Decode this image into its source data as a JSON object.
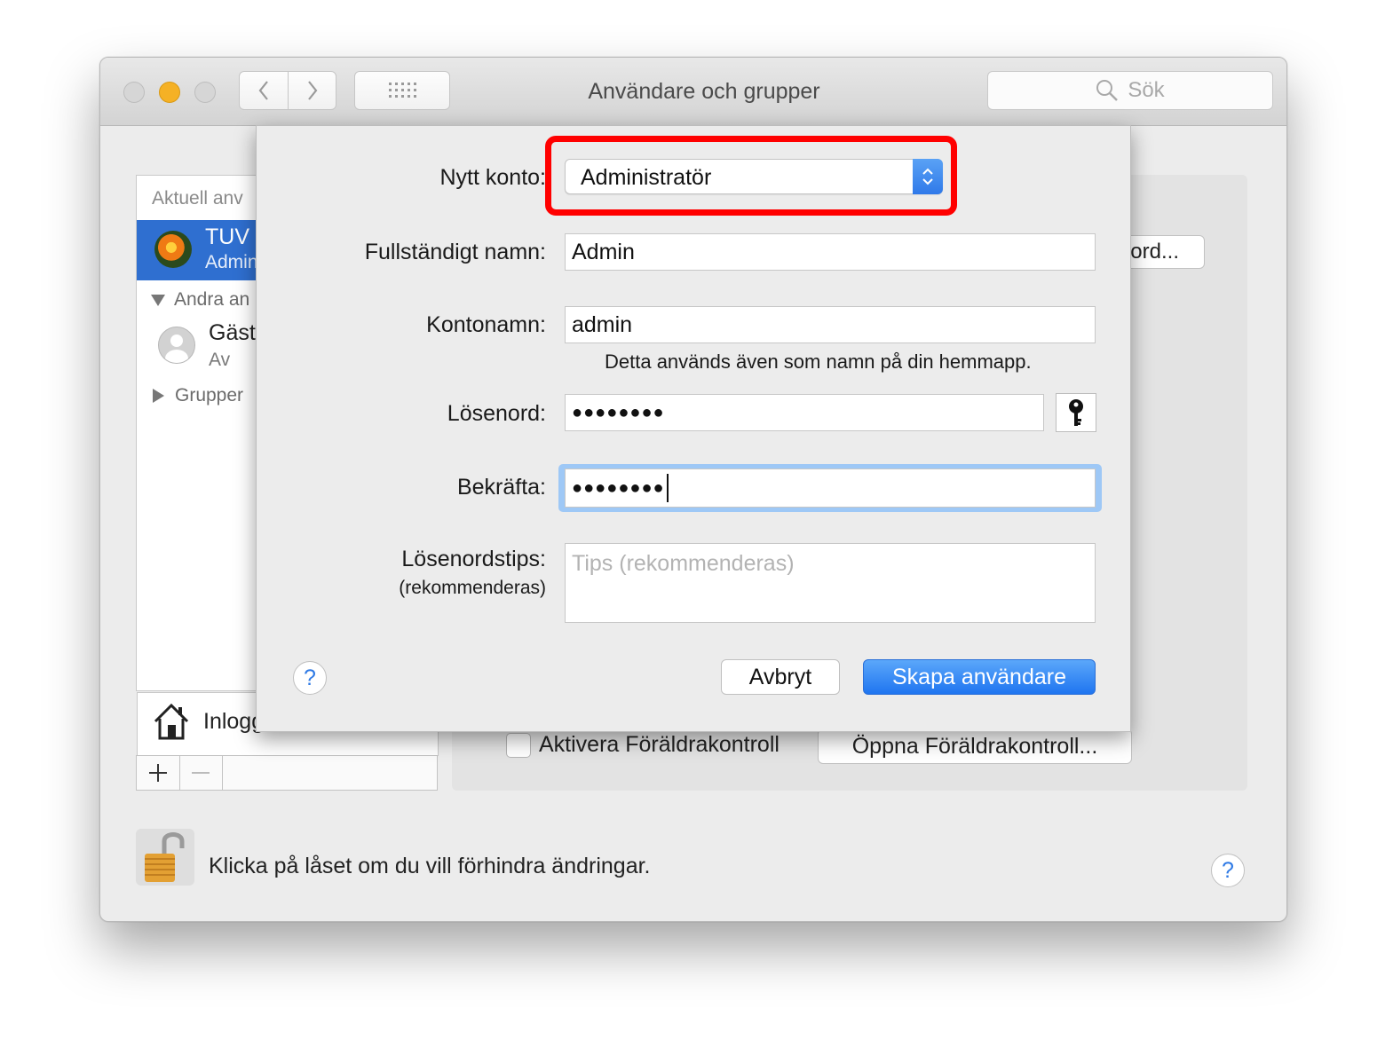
{
  "window": {
    "title": "Användare och grupper",
    "search_placeholder": "Sök"
  },
  "sidebar": {
    "header": "Aktuell anv",
    "current_user": {
      "name": "TUV",
      "role": "Admin"
    },
    "other_users_header": "Andra an",
    "guest": {
      "name": "Gäst",
      "status": "Av"
    },
    "groups_label": "Grupper",
    "login_options": "Inlogg"
  },
  "panel": {
    "password_button": "ord...",
    "parental_checkbox_label": "Aktivera Föräldrakontroll",
    "parental_open_button": "Öppna Föräldrakontroll..."
  },
  "lock": {
    "text": "Klicka på låset om du vill förhindra ändringar."
  },
  "sheet": {
    "new_account_label": "Nytt konto:",
    "account_type": "Administratör",
    "full_name_label": "Fullständigt namn:",
    "full_name_value": "Admin",
    "account_name_label": "Kontonamn:",
    "account_name_value": "admin",
    "account_name_hint": "Detta används även som namn på din hemmapp.",
    "password_label": "Lösenord:",
    "password_value": "●●●●●●●●",
    "confirm_label": "Bekräfta:",
    "confirm_value": "●●●●●●●●",
    "hint_label": "Lösenordstips:",
    "hint_sublabel": "(rekommenderas)",
    "hint_placeholder": "Tips (rekommenderas)",
    "cancel_button": "Avbryt",
    "create_button": "Skapa användare",
    "help_symbol": "?"
  },
  "colors": {
    "accent": "#2f79e9",
    "highlight_box": "#ff0000",
    "selection": "#2f6fd0"
  }
}
